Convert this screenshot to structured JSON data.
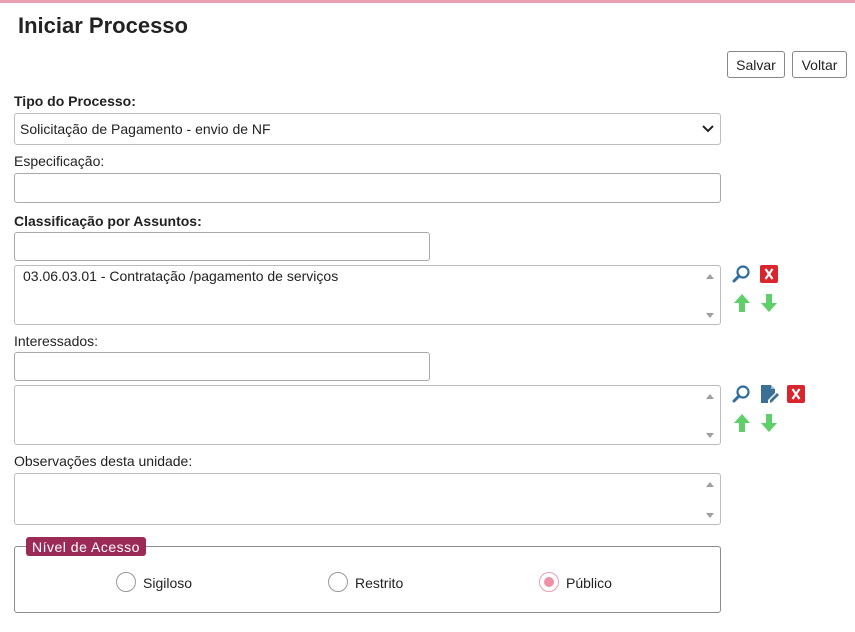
{
  "page": {
    "title": "Iniciar Processo"
  },
  "toolbar": {
    "save_label": "Salvar",
    "back_label": "Voltar"
  },
  "tipo_processo": {
    "label": "Tipo do Processo:",
    "selected": "Solicitação de Pagamento - envio de NF"
  },
  "especificacao": {
    "label": "Especificação:",
    "value": ""
  },
  "classificacao": {
    "label": "Classificação por Assuntos:",
    "search_value": "",
    "items": [
      "03.06.03.01 - Contratação /pagamento de serviços"
    ]
  },
  "interessados": {
    "label": "Interessados:",
    "search_value": "",
    "items": []
  },
  "observacoes": {
    "label": "Observações desta unidade:",
    "value": ""
  },
  "nivel_acesso": {
    "legend": "Nível de Acesso",
    "options": [
      {
        "label": "Sigiloso",
        "checked": false
      },
      {
        "label": "Restrito",
        "checked": false
      },
      {
        "label": "Público",
        "checked": true
      }
    ]
  },
  "colors": {
    "accent": "#9c2a57",
    "top_bar": "#e9a0b2",
    "remove_red": "#d9262e",
    "arrow_green": "#5fcf6a",
    "search_blue": "#2d6fa3"
  },
  "icons": [
    "search-icon",
    "remove-icon",
    "move-up-icon",
    "move-down-icon",
    "edit-icon"
  ]
}
